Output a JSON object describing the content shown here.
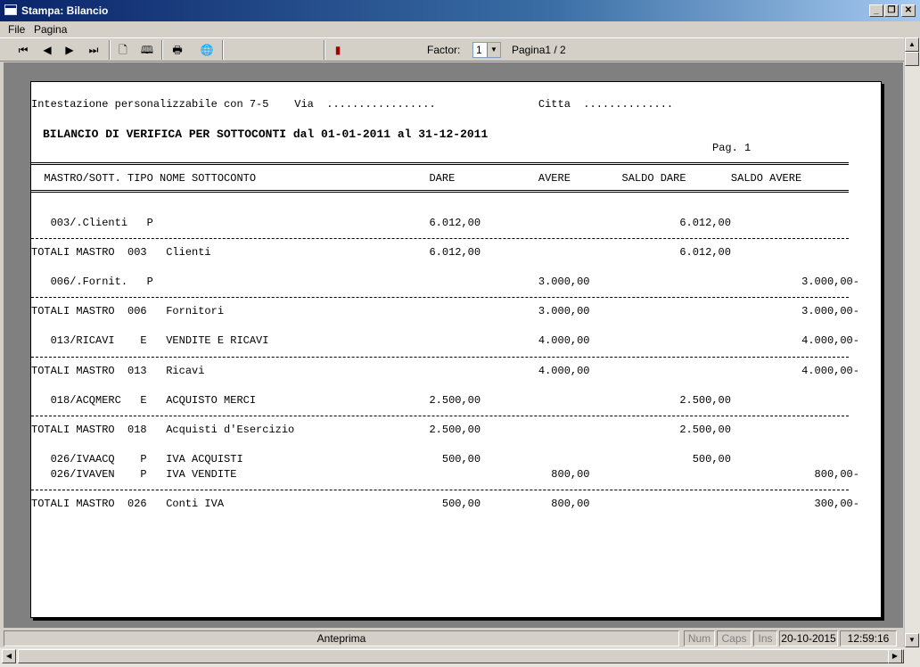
{
  "window": {
    "title": "Stampa: Bilancio"
  },
  "menu": [
    "File",
    "Pagina"
  ],
  "toolbar": {
    "factor_label": "Factor:",
    "factor_value": "1",
    "page_label": "Pagina1 / 2"
  },
  "report": {
    "header_line": "Intestazione personalizzabile con 7-5    Via  .................                Citta  ..............",
    "title": "BILANCIO DI VERIFICA PER SOTTOCONTI dal 01-01-2011 al 31-12-2011",
    "page": "Pag. 1",
    "columns_line": "  MASTRO/SOTT. TIPO NOME SOTTOCONTO                           DARE             AVERE        SALDO DARE       SALDO AVERE",
    "rows": [
      "   003/.Clienti   P                                           6.012,00                               6.012,00",
      "TOTALI MASTRO  003   Clienti                                  6.012,00                               6.012,00",
      "   006/.Fornit.   P                                                            3.000,00                                 3.000,00-",
      "TOTALI MASTRO  006   Fornitori                                                 3.000,00                                 3.000,00-",
      "   013/RICAVI    E   VENDITE E RICAVI                                          4.000,00                                 4.000,00-",
      "TOTALI MASTRO  013   Ricavi                                                    4.000,00                                 4.000,00-",
      "   018/ACQMERC   E   ACQUISTO MERCI                           2.500,00                               2.500,00",
      "TOTALI MASTRO  018   Acquisti d'Esercizio                     2.500,00                               2.500,00",
      "   026/IVAACQ    P   IVA ACQUISTI                               500,00                                 500,00",
      "   026/IVAVEN    P   IVA VENDITE                                                 800,00                                   800,00-",
      "TOTALI MASTRO  026   Conti IVA                                  500,00           800,00                                   300,00-"
    ]
  },
  "status": {
    "mode": "Anteprima",
    "num": "Num",
    "caps": "Caps",
    "ins": "Ins",
    "date": "20-10-2015",
    "time": "12:59:16"
  }
}
